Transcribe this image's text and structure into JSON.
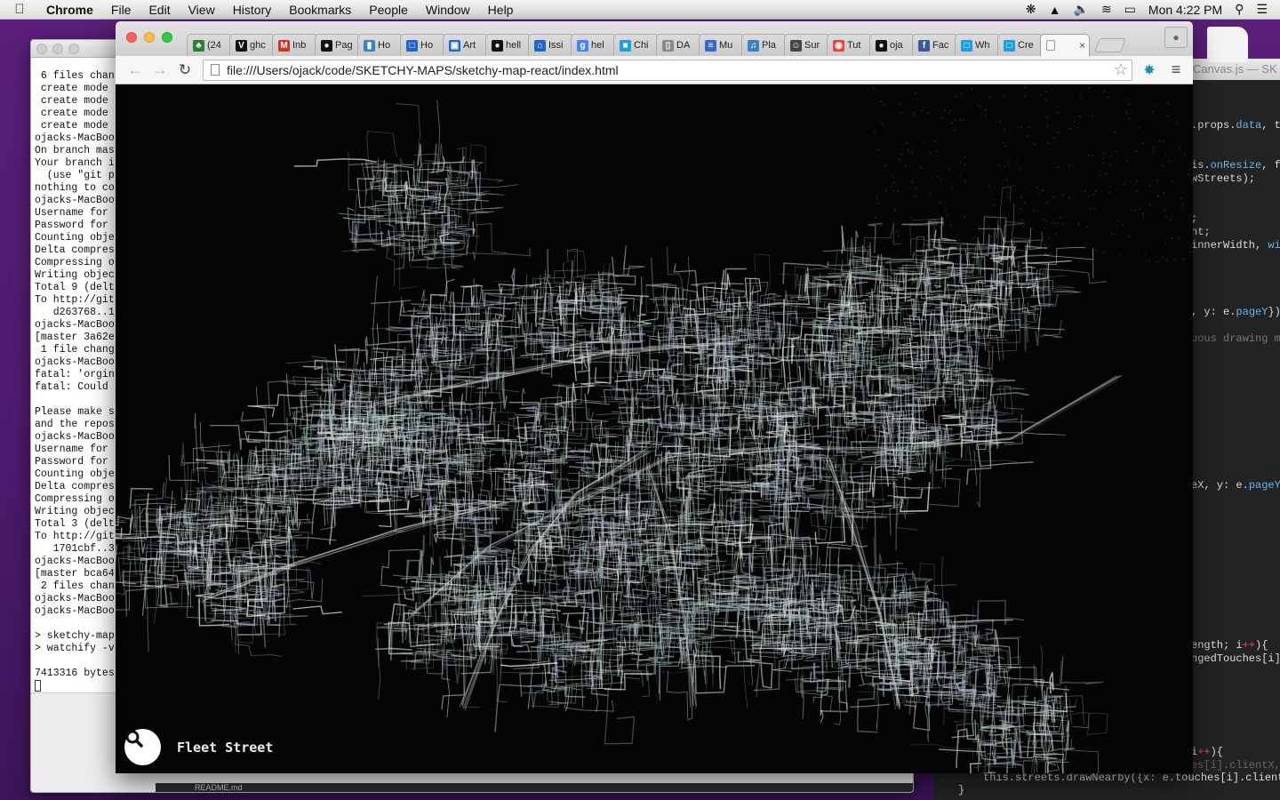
{
  "menubar": {
    "app_name": "Chrome",
    "items": [
      "File",
      "Edit",
      "View",
      "History",
      "Bookmarks",
      "People",
      "Window",
      "Help"
    ],
    "clock": "Mon 4:22 PM"
  },
  "terminal": {
    "lines": [
      " 6 files chan",
      " create mode",
      " create mode",
      " create mode",
      " create mode",
      "ojacks-MacBoo",
      "On branch mas",
      "Your branch i",
      "  (use \"git p",
      "nothing to co",
      "ojacks-MacBoo",
      "Username for",
      "Password for",
      "Counting obje",
      "Delta compres",
      "Compressing o",
      "Writing objec",
      "Total 9 (delt",
      "To http://git",
      "   d263768..1",
      "ojacks-MacBoo",
      "[master 3a62e",
      " 1 file chang",
      "ojacks-MacBoo",
      "fatal: 'orgin",
      "fatal: Could",
      "",
      "Please make s",
      "and the repos",
      "ojacks-MacBoo",
      "Username for",
      "Password for",
      "Counting obje",
      "Delta compres",
      "Compressing o",
      "Writing objec",
      "Total 3 (delt",
      "To http://git",
      "   1701cbf..3",
      "ojacks-MacBoo",
      "[master bca64",
      " 2 files chan",
      "ojacks-MacBoo",
      "ojacks-MacBoo",
      "",
      "> sketchy-map",
      "> watchify -v",
      "",
      "7413316 bytes"
    ],
    "footer_file": "README.md"
  },
  "editor": {
    "title": "Canvas.js — SK",
    "last_line": "this.streets.drawNearby({x: e.touches[i].clientX",
    "close_brace": "}"
  },
  "chrome": {
    "tabs": [
      {
        "label": "(24",
        "icon": "dog-icon",
        "color": "#2e7d32"
      },
      {
        "label": "ghc",
        "icon": "v-icon",
        "color": "#111111"
      },
      {
        "label": "Inb",
        "icon": "gmail-icon",
        "color": "#d93025"
      },
      {
        "label": "Pag",
        "icon": "github-icon",
        "color": "#111111"
      },
      {
        "label": "Ho",
        "icon": "bottle-icon",
        "color": "#3b82c4"
      },
      {
        "label": "Ho",
        "icon": "square-icon",
        "color": "#1e66c9"
      },
      {
        "label": "Art",
        "icon": "art-icon",
        "color": "#1e66c9"
      },
      {
        "label": "hell",
        "icon": "github-icon",
        "color": "#111111"
      },
      {
        "label": "Issi",
        "icon": "house-icon",
        "color": "#1e66c9"
      },
      {
        "label": "hel",
        "icon": "google-icon",
        "color": "#4285f4"
      },
      {
        "label": "Chi",
        "icon": "chart-icon",
        "color": "#1ba1e2"
      },
      {
        "label": "DA",
        "icon": "doc-icon",
        "color": "#888888"
      },
      {
        "label": "Mu",
        "icon": "docs-icon",
        "color": "#3367d6"
      },
      {
        "label": "Pla",
        "icon": "music-icon",
        "color": "#3b82c4"
      },
      {
        "label": "Sur",
        "icon": "monkey-icon",
        "color": "#444444"
      },
      {
        "label": "Tut",
        "icon": "chrome-icon",
        "color": "#e8453c"
      },
      {
        "label": "oja",
        "icon": "github-icon",
        "color": "#111111"
      },
      {
        "label": "Fac",
        "icon": "facebook-icon",
        "color": "#3b5998"
      },
      {
        "label": "Wh",
        "icon": "square-icon",
        "color": "#1ba1e2"
      },
      {
        "label": "Cre",
        "icon": "square-icon",
        "color": "#1ba1e2"
      }
    ],
    "active_tab_close": "×",
    "url": "file:///Users/ojack/code/SKETCHY-MAPS/sketchy-map-react/index.html"
  },
  "page": {
    "location_label": "Fleet Street",
    "search_icon": "search-icon"
  }
}
